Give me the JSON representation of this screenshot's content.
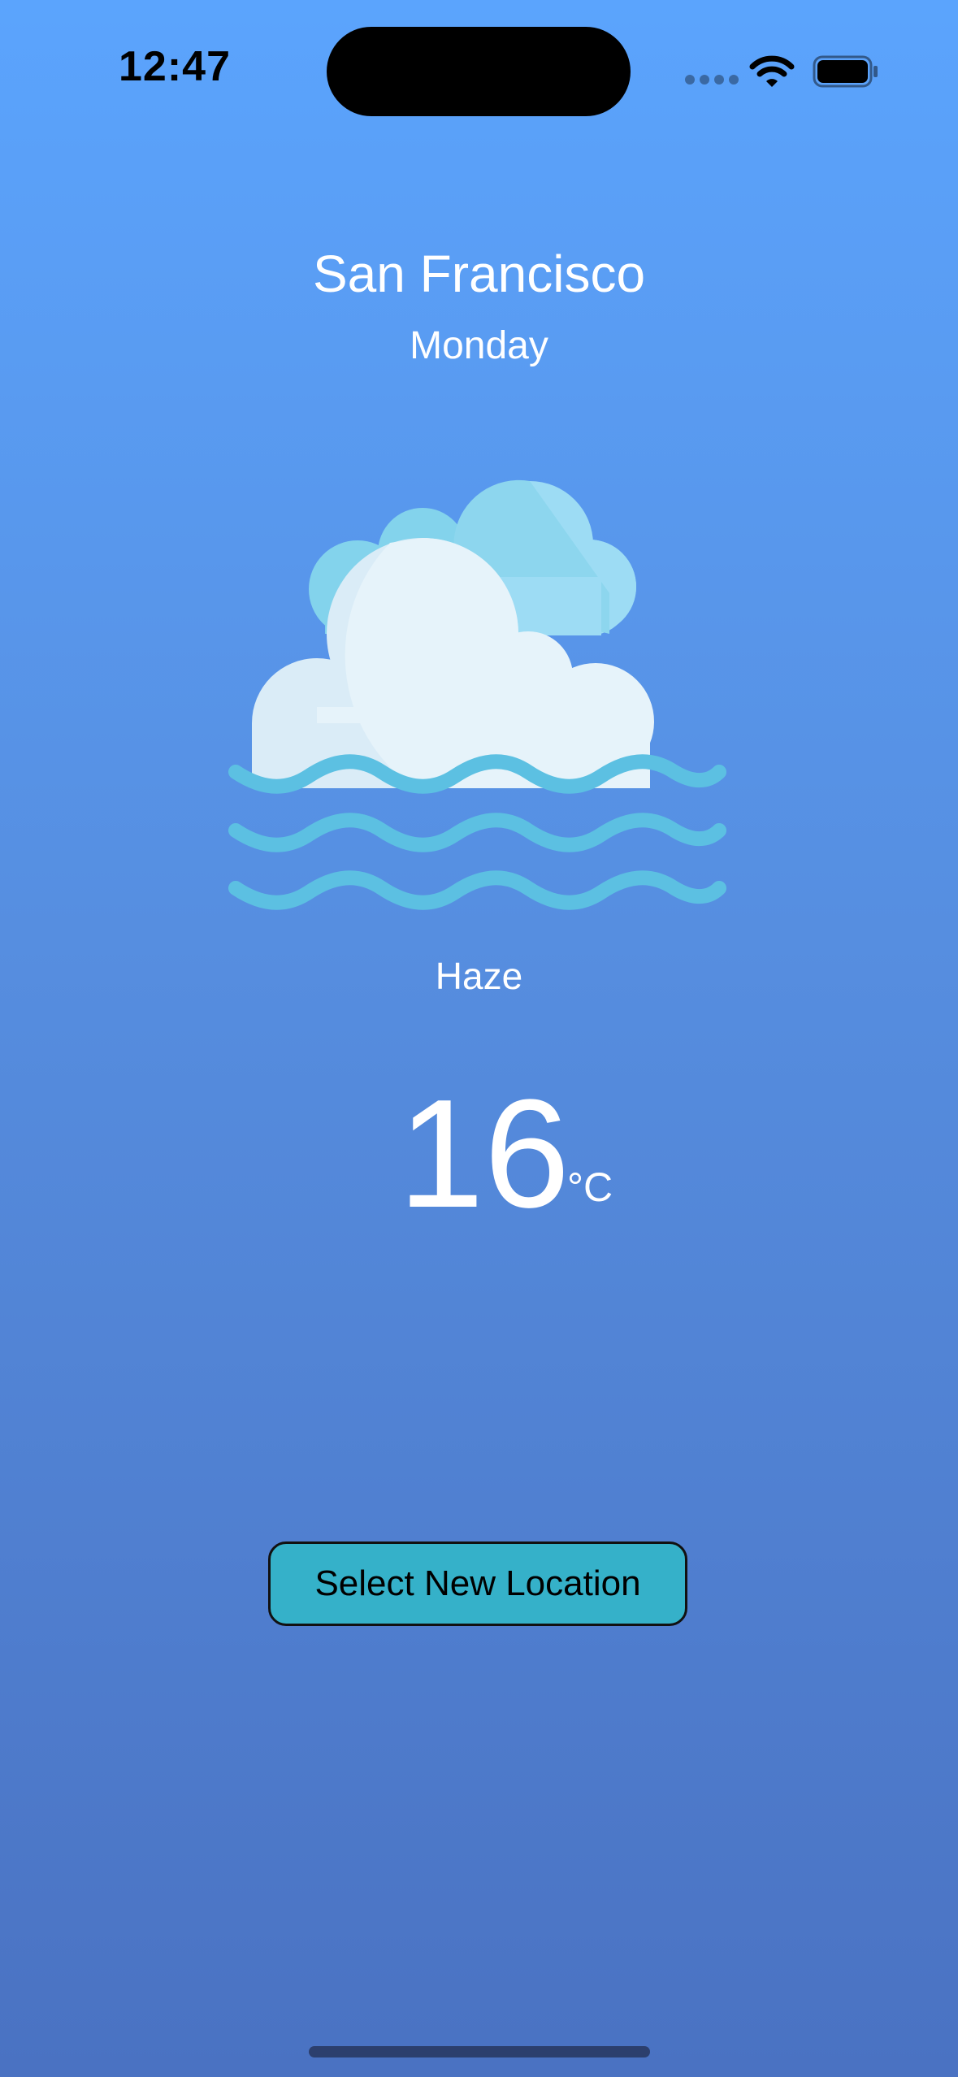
{
  "status_bar": {
    "time": "12:47",
    "signal_icon": "signal-dots-icon",
    "wifi_icon": "wifi-icon",
    "battery_icon": "battery-icon"
  },
  "location": {
    "city": "San Francisco",
    "day": "Monday"
  },
  "weather": {
    "icon": "haze-cloud-icon",
    "condition": "Haze",
    "temperature": "16",
    "unit": "°C"
  },
  "actions": {
    "select_location_label": "Select New Location"
  },
  "colors": {
    "background_top": "#5ba4fd",
    "background_bottom": "#4a72c2",
    "button_fill": "#35b1c9",
    "wave": "#5cc0e2",
    "cloud_front": "#e6f3fa",
    "cloud_back": "#9ddcf4"
  }
}
